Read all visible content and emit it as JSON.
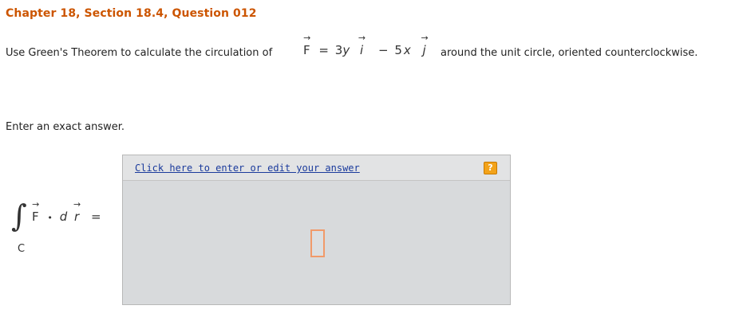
{
  "header": {
    "title": "Chapter 18, Section 18.4, Question 012"
  },
  "question": {
    "text_before": "Use Green's Theorem to calculate the circulation of",
    "text_after": "around the unit circle, oriented counterclockwise.",
    "formula": {
      "F": "F",
      "eq": "=",
      "coef1": "3",
      "var1": "y",
      "i": "i",
      "minus": "−",
      "coef2": "5",
      "var2": "x",
      "j": "j",
      "arrow": "→"
    }
  },
  "instruction": "Enter an exact answer.",
  "integral": {
    "sign": "∫",
    "sub": "C",
    "F": "F",
    "dot": "•",
    "d": "d",
    "r": "r",
    "eq": "="
  },
  "answer": {
    "link_text": "Click here to enter or edit your answer",
    "help_label": "?"
  },
  "colors": {
    "title": "#cc5500",
    "link": "#1a3a9c",
    "help_icon": "#f3a31a",
    "answer_bg": "#d8dadc",
    "input_border": "#f19a6a"
  }
}
